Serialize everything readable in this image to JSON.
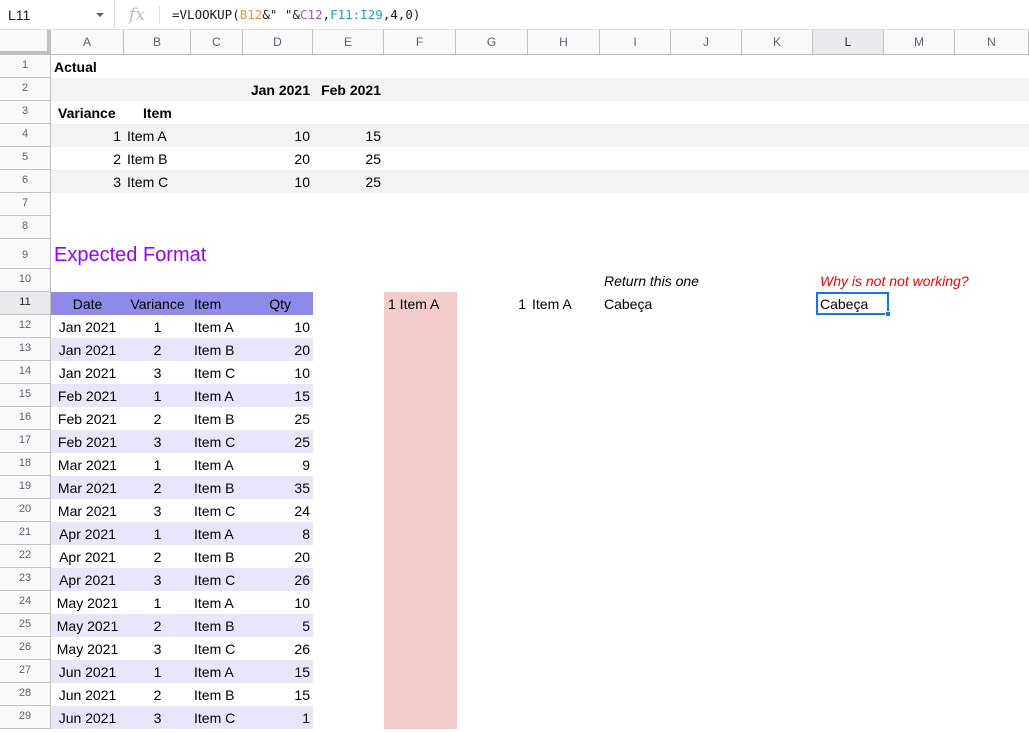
{
  "formula_bar": {
    "name_box": "L11",
    "fx_label": "fx",
    "formula_parts": [
      {
        "text": "=VLOOKUP(",
        "cls": ""
      },
      {
        "text": "B12",
        "cls": "f-b"
      },
      {
        "text": "&\" \"&",
        "cls": ""
      },
      {
        "text": "C12",
        "cls": "f-c"
      },
      {
        "text": ",",
        "cls": ""
      },
      {
        "text": "F11:I29",
        "cls": "f-r"
      },
      {
        "text": ",4,0)",
        "cls": ""
      }
    ]
  },
  "columns": [
    "A",
    "B",
    "C",
    "D",
    "E",
    "F",
    "G",
    "H",
    "I",
    "J",
    "K",
    "L",
    "M",
    "N"
  ],
  "selected_column": "L",
  "rows": [
    1,
    2,
    3,
    4,
    5,
    6,
    7,
    8,
    9,
    10,
    11,
    12,
    13,
    14,
    15,
    16,
    17,
    18,
    19,
    20,
    21,
    22,
    23,
    24,
    25,
    26,
    27,
    28,
    29
  ],
  "selected_row": 11,
  "actual": {
    "title": "Actual",
    "months": [
      "Jan 2021",
      "Feb 2021"
    ],
    "headers": {
      "variance": "Variance",
      "item": "Item"
    },
    "rows": [
      {
        "variance": "1",
        "item": "Item A",
        "jan": "10",
        "feb": "15"
      },
      {
        "variance": "2",
        "item": "Item B",
        "jan": "20",
        "feb": "25"
      },
      {
        "variance": "3",
        "item": "Item C",
        "jan": "10",
        "feb": "25"
      }
    ]
  },
  "expected": {
    "title": "Expected Format",
    "headers": [
      "Date",
      "Variance",
      "Item",
      "Qty"
    ],
    "header_color": "#8e8ae8",
    "band_color": "#e8e6fb",
    "rows": [
      [
        "Jan 2021",
        "1",
        "Item A",
        "10"
      ],
      [
        "Jan 2021",
        "2",
        "Item B",
        "20"
      ],
      [
        "Jan 2021",
        "3",
        "Item C",
        "10"
      ],
      [
        "Feb 2021",
        "1",
        "Item A",
        "15"
      ],
      [
        "Feb 2021",
        "2",
        "Item B",
        "25"
      ],
      [
        "Feb 2021",
        "3",
        "Item C",
        "25"
      ],
      [
        "Mar 2021",
        "1",
        "Item A",
        "9"
      ],
      [
        "Mar 2021",
        "2",
        "Item B",
        "35"
      ],
      [
        "Mar 2021",
        "3",
        "Item C",
        "24"
      ],
      [
        "Apr 2021",
        "1",
        "Item A",
        "8"
      ],
      [
        "Apr 2021",
        "2",
        "Item B",
        "20"
      ],
      [
        "Apr 2021",
        "3",
        "Item C",
        "26"
      ],
      [
        "May 2021",
        "1",
        "Item A",
        "10"
      ],
      [
        "May 2021",
        "2",
        "Item B",
        "5"
      ],
      [
        "May 2021",
        "3",
        "Item C",
        "26"
      ],
      [
        "Jun 2021",
        "1",
        "Item A",
        "15"
      ],
      [
        "Jun 2021",
        "2",
        "Item B",
        "15"
      ],
      [
        "Jun 2021",
        "3",
        "Item C",
        "1"
      ]
    ]
  },
  "lookup": {
    "key_cell": "1 Item A",
    "key_fill": "#f4cccc",
    "g_value": "1",
    "h_value": "Item A",
    "return_label": "Return this one",
    "return_value": "Cabeça",
    "question_label": "Why is not not working?",
    "result_value": "Cabeça"
  }
}
